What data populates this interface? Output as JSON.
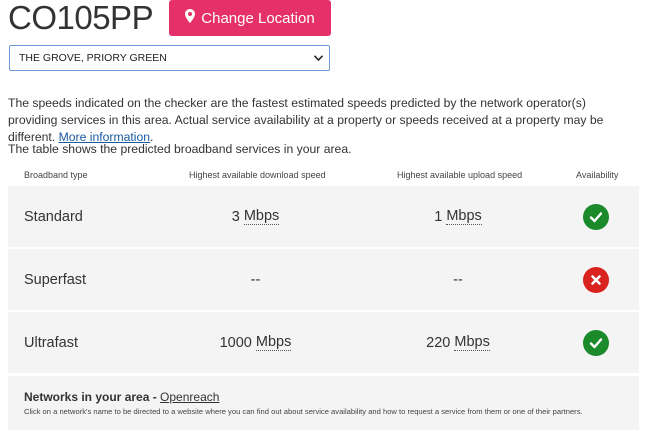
{
  "header": {
    "postcode": "CO105PP",
    "change_location_label": "Change Location",
    "change_location_icon": "map-marker-icon",
    "button_color": "#e5306a"
  },
  "address_select": {
    "selected": "THE GROVE, PRIORY GREEN",
    "icon": "chevron-down-icon"
  },
  "intro": {
    "text": "The speeds indicated on the checker are the fastest estimated speeds predicted by the network operator(s) providing services in this area. Actual service availability at a property or speeds received at a property may be different.",
    "more_info_link": "More information",
    "after_link": ".",
    "table_intro": "The table shows the predicted broadband services in your area."
  },
  "table": {
    "headers": [
      "Broadband type",
      "Highest available download speed",
      "Highest available upload speed",
      "Availability"
    ],
    "rows": [
      {
        "type": "Standard",
        "download_value": "3",
        "download_unit": "Mbps",
        "upload_value": "1",
        "upload_unit": "Mbps",
        "available": true
      },
      {
        "type": "Superfast",
        "download_value": "--",
        "download_unit": "",
        "upload_value": "--",
        "upload_unit": "",
        "available": false
      },
      {
        "type": "Ultrafast",
        "download_value": "1000",
        "download_unit": "Mbps",
        "upload_value": "220",
        "upload_unit": "Mbps",
        "available": true
      }
    ],
    "available_color": "#1a8a2a",
    "unavailable_color": "#d9221f"
  },
  "networks": {
    "title": "Networks in your area - ",
    "link": "Openreach",
    "note": "Click on a network's name to be directed to a website where you can find out about service availability and how to request a service from them or one of their partners."
  }
}
